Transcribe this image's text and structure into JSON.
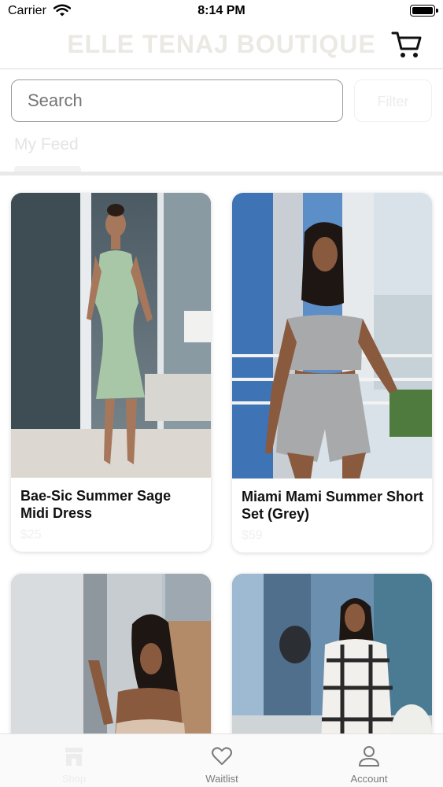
{
  "status_bar": {
    "carrier": "Carrier",
    "time": "8:14 PM"
  },
  "header": {
    "title": "ELLE TENAJ BOUTIQUE",
    "cart_icon": "cart-icon"
  },
  "search": {
    "placeholder": "Search",
    "filter_label": "Filter"
  },
  "feed": {
    "tab_label": "My Feed"
  },
  "products": [
    {
      "title": "Bae-Sic Summer Sage Midi Dress",
      "price": "$25"
    },
    {
      "title": "Miami Mami Summer Short Set (Grey)",
      "price": "$59"
    },
    {
      "title": "",
      "price": ""
    },
    {
      "title": "",
      "price": ""
    }
  ],
  "tabbar": {
    "items": [
      {
        "label": "Shop",
        "icon": "store-icon"
      },
      {
        "label": "Waitlist",
        "icon": "heart-icon"
      },
      {
        "label": "Account",
        "icon": "person-icon"
      }
    ]
  },
  "colors": {
    "accent_faded": "#ebe9e4",
    "text": "#111111",
    "inactive": "#7a7a7a"
  }
}
